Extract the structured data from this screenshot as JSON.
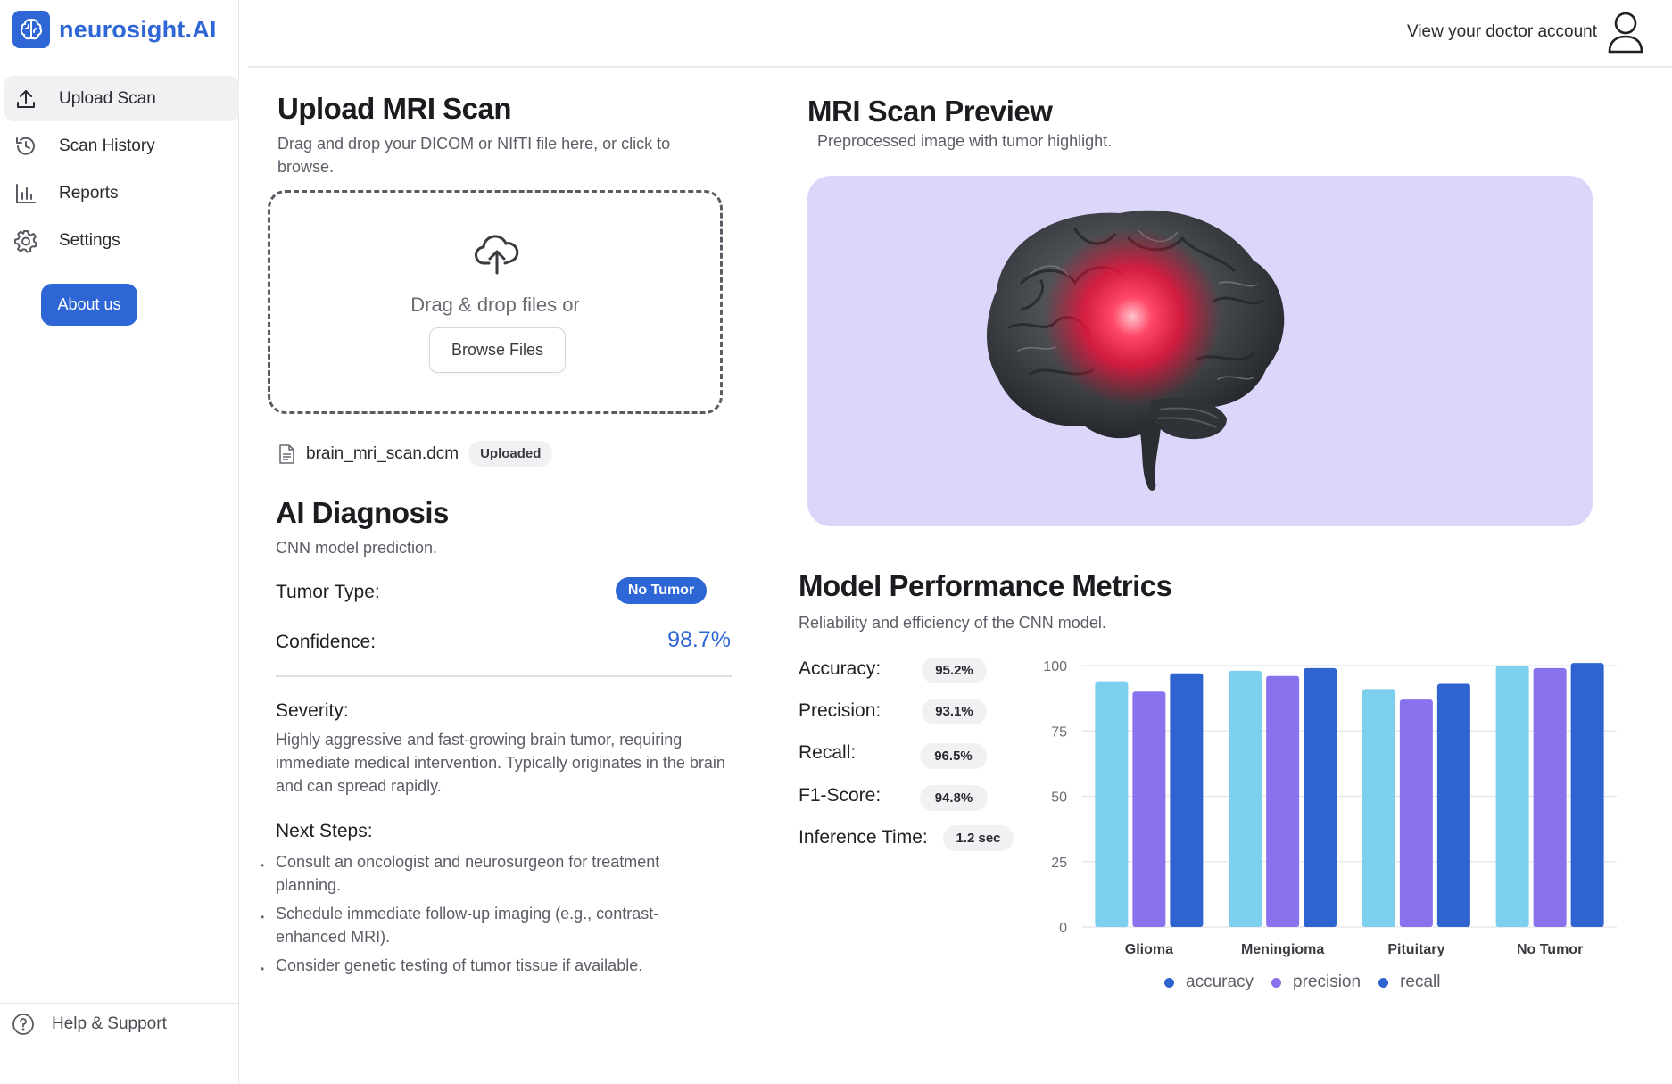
{
  "brand": {
    "name": "neurosight.AI"
  },
  "sidebar": {
    "items": [
      {
        "label": "Upload Scan",
        "icon": "upload-icon",
        "active": true
      },
      {
        "label": "Scan History",
        "icon": "history-icon",
        "active": false
      },
      {
        "label": "Reports",
        "icon": "bar-chart-icon",
        "active": false
      },
      {
        "label": "Settings",
        "icon": "gear-icon",
        "active": false
      }
    ],
    "about_label": "About us",
    "help_label": "Help & Support"
  },
  "header": {
    "account_label": "View your doctor account"
  },
  "upload": {
    "title": "Upload MRI Scan",
    "subtitle": "Drag and drop your DICOM or NIfTI file here, or click to browse.",
    "drop_text": "Drag & drop files or",
    "browse_label": "Browse Files",
    "file_name": "brain_mri_scan.dcm",
    "file_status": "Uploaded"
  },
  "diagnosis": {
    "title": "AI Diagnosis",
    "subtitle": "CNN model prediction.",
    "tumor_type_label": "Tumor Type:",
    "tumor_type_value": "No Tumor",
    "confidence_label": "Confidence:",
    "confidence_value": "98.7%",
    "severity_label": "Severity:",
    "severity_text": "Highly aggressive and fast-growing brain tumor, requiring immediate medical intervention. Typically originates in the brain and can spread rapidly.",
    "next_steps_label": "Next Steps:",
    "next_steps": [
      "Consult an oncologist and neurosurgeon for treatment planning.",
      "Schedule immediate follow-up imaging (e.g., contrast-enhanced MRI).",
      "Consider genetic testing of tumor tissue if available."
    ]
  },
  "preview": {
    "title": "MRI Scan Preview",
    "subtitle": "Preprocessed image with tumor highlight."
  },
  "metrics": {
    "title": "Model Performance Metrics",
    "subtitle": "Reliability and efficiency of the CNN model.",
    "items": [
      {
        "label": "Accuracy:",
        "value": "95.2%"
      },
      {
        "label": "Precision:",
        "value": "93.1%"
      },
      {
        "label": "Recall:",
        "value": "96.5%"
      },
      {
        "label": "F1-Score:",
        "value": "94.8%"
      },
      {
        "label": "Inference Time:",
        "value": "1.2 sec"
      }
    ]
  },
  "colors": {
    "accent": "#2e66d6",
    "accuracy": "#7dcfee",
    "precision": "#8a72ee",
    "recall": "#2f63cf",
    "preview_bg": "#dcd6fb"
  },
  "chart_data": {
    "type": "bar",
    "categories": [
      "Glioma",
      "Meningioma",
      "Pituitary",
      "No Tumor"
    ],
    "series": [
      {
        "name": "accuracy",
        "values": [
          94,
          98,
          91,
          100
        ]
      },
      {
        "name": "precision",
        "values": [
          90,
          96,
          87,
          99
        ]
      },
      {
        "name": "recall",
        "values": [
          97,
          99,
          93,
          101
        ]
      }
    ],
    "ylim": [
      0,
      100
    ],
    "yticks": [
      0,
      25,
      50,
      75,
      100
    ],
    "grid": true,
    "legend": "bottom"
  }
}
